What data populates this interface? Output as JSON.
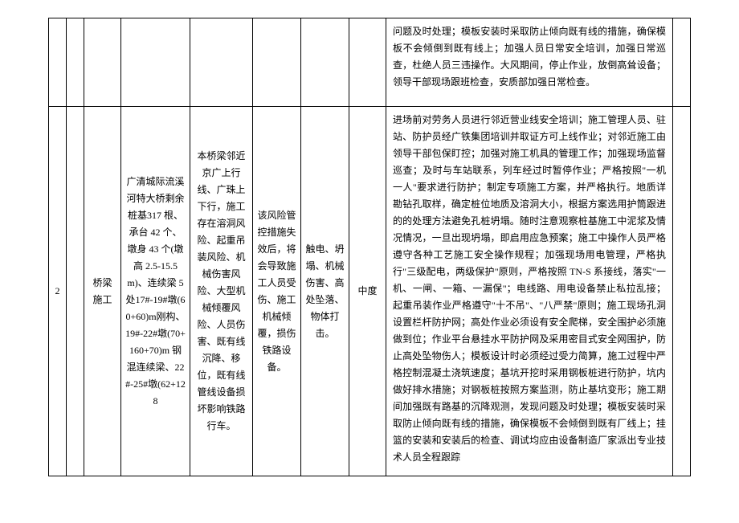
{
  "row1": {
    "c0": "",
    "c1": "",
    "c2": "",
    "c3": "",
    "c4": "",
    "c5": "",
    "c6": "",
    "c7": "",
    "c8": "问题及时处理；模板安装时采取防止倾向既有线的措施，确保模板不会倾倒到既有线上；加强人员日常安全培训，加强日常巡查，杜绝人员三违操作。大风期间，停止作业，放倒高耸设备；领导干部现场跟班检查，安质部加强日常检查。",
    "c9": ""
  },
  "row2": {
    "c0": "2",
    "c1": "",
    "c2": "桥梁施工",
    "c3": "广清城际流溪河特大桥剩余桩基317 根、承台 42 个、墩身 43 个(墩高 2.5-15.5m)、连续梁 5 处17#-19#墩(60+60)m刚构、19#-22#墩(70+160+70)m 钢混连续梁、22#-25#墩(62+128",
    "c4": "本桥梁邻近京广上行线、广珠上下行，施工存在溶洞风险、起重吊装风险、机械伤害风险、大型机械倾覆风险、人员伤害、既有线沉降、移位，既有线管线设备损坏影响铁路行车。",
    "c5": "该风险管控措施失效后，将会导致施工人员受伤、施工机械倾覆，损伤铁路设备。",
    "c6": "触电、坍塌、机械伤害、高处坠落、物体打击。",
    "c7": "中度",
    "c8": "进场前对劳务人员进行邻近营业线安全培训；施工管理人员、驻站、防护员经广铁集团培训并取证方可上线作业；对邻近施工由领导干部包保盯控；加强对施工机具的管理工作；加强现场监督巡查；及时与车站联系，列车经过时暂停作业；严格按照\"一机一人\"要求进行防护；制定专项施工方案，并严格执行。地质详勘钻孔取样，确定桩位地质及溶洞大小，根据方案选用护筒跟进的的处理方法避免孔桩坍塌。随时注意观察桩基施工中泥浆及情况情况，一旦出现坍塌，即启用应急预案；施工中操作人员严格遵守各种工艺施工安全操作规程；加强现场用电管理，严格执行\"三级配电，两级保护\"原则，严格按照 TN-S 系接线，落实\"一机、一闸、一箱、一漏保\"；电线路、用电设备禁止私拉乱接；起重吊装作业严格遵守\"十不吊\"、\"八严禁\"原则；施工现场孔洞设置栏杆防护网；高处作业必须设有安全爬梯，安全围护必须施做到位；作业平台悬挂水平防护网及采用密目式安全网围护，防止高处坠物伤人；模板设计时必须经过受力简算，施工过程中严格控制混凝土浇筑速度；基坑开挖时采用钢板桩进行防护，坑内做好排水措施；对钢板桩按照方案监测，防止基坑变形；施工期间加强既有路基的沉降观测，发现问题及时处理；模板安装时采取防止倾向既有线的措施，确保模板不会倾倒到既有厂线上；挂篮的安装和安装后的检查、调试均应由设备制造厂家派出专业技术人员全程跟踪",
    "c9": ""
  }
}
